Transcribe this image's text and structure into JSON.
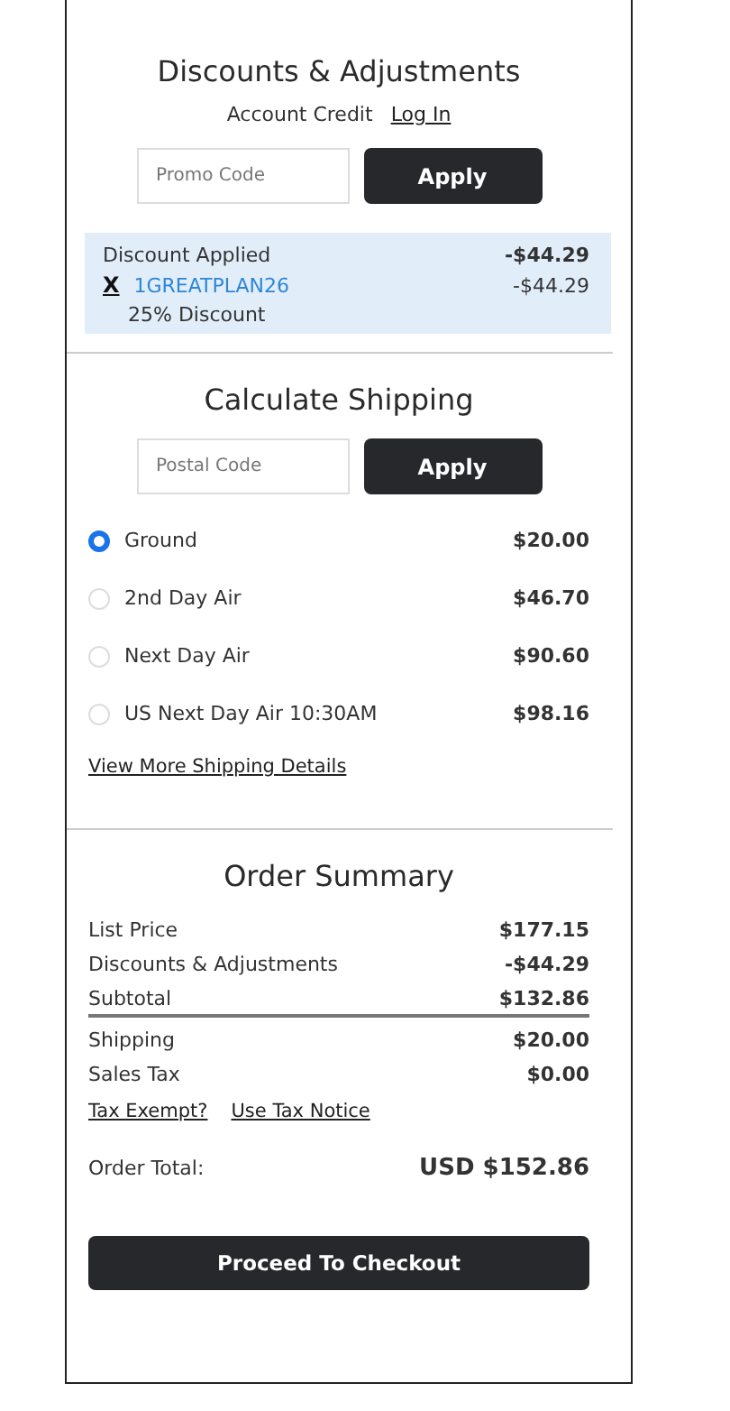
{
  "discounts": {
    "title": "Discounts & Adjustments",
    "account_credit": {
      "label": "Account Credit",
      "link": "Log In"
    },
    "promo": {
      "placeholder": "Promo Code",
      "button": "Apply"
    },
    "applied": {
      "label": "Discount Applied",
      "amount": "-$44.29",
      "remove": "X",
      "code": "1GREATPLAN26",
      "code_amount": "-$44.29",
      "description": "25% Discount"
    }
  },
  "shipping": {
    "title": "Calculate Shipping",
    "postal": {
      "placeholder": "Postal Code",
      "button": "Apply"
    },
    "options": [
      {
        "label": "Ground",
        "price": "$20.00",
        "selected": true
      },
      {
        "label": "2nd Day Air",
        "price": "$46.70",
        "selected": false
      },
      {
        "label": "Next Day Air",
        "price": "$90.60",
        "selected": false
      },
      {
        "label": "US Next Day Air 10:30AM",
        "price": "$98.16",
        "selected": false
      }
    ],
    "details_link": "View More Shipping Details"
  },
  "summary": {
    "title": "Order Summary",
    "rows": [
      {
        "label": "List Price",
        "value": "$177.15"
      },
      {
        "label": "Discounts & Adjustments",
        "value": "-$44.29"
      },
      {
        "label": "Subtotal",
        "value": "$132.86"
      }
    ],
    "rows_after_rule": [
      {
        "label": "Shipping",
        "value": "$20.00"
      },
      {
        "label": "Sales Tax",
        "value": "$0.00"
      }
    ],
    "links": [
      "Tax Exempt?",
      "Use Tax Notice"
    ],
    "total": {
      "label": "Order Total:",
      "value": "USD $152.86"
    },
    "checkout_button": "Proceed To Checkout"
  }
}
